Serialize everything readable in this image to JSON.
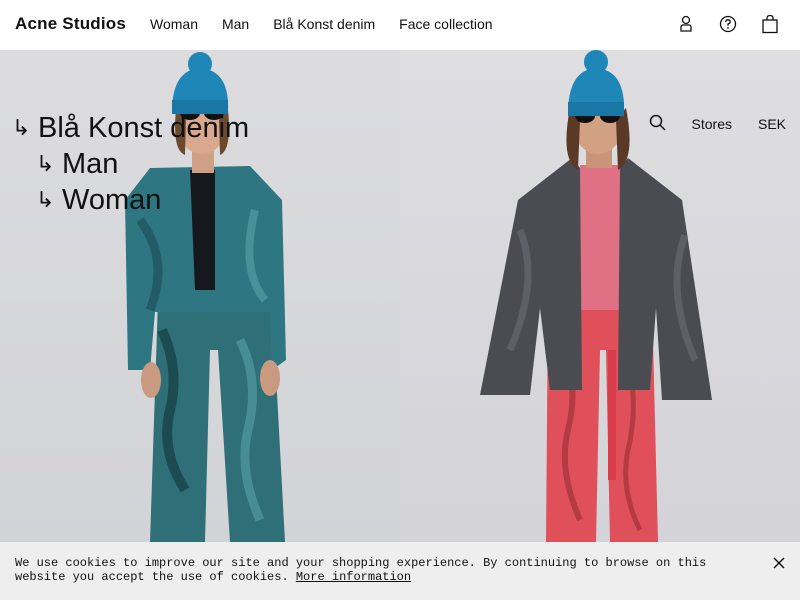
{
  "header": {
    "logo": "Acne Studios",
    "nav": [
      {
        "label": "Woman"
      },
      {
        "label": "Man"
      },
      {
        "label": "Blå Konst denim"
      },
      {
        "label": "Face collection"
      }
    ],
    "icons": [
      "user-icon",
      "help-icon",
      "bag-icon"
    ]
  },
  "breadcrumbs": {
    "root": "Blå Konst denim",
    "children": [
      "Man",
      "Woman"
    ]
  },
  "right_bar": {
    "search_icon": "search-icon",
    "stores": "Stores",
    "currency": "SEK"
  },
  "cookie": {
    "text": "We use cookies to improve our site and your shopping experience. By continuing to browse on this website you accept the use of cookies.",
    "link": "More information",
    "close_icon": "close-icon"
  },
  "colors": {
    "beanie": "#1f86b8",
    "teal_denim": "#2f6f78",
    "grey_denim": "#4a4c52",
    "pink_shirt": "#e07083",
    "red_jeans": "#e0505a"
  }
}
